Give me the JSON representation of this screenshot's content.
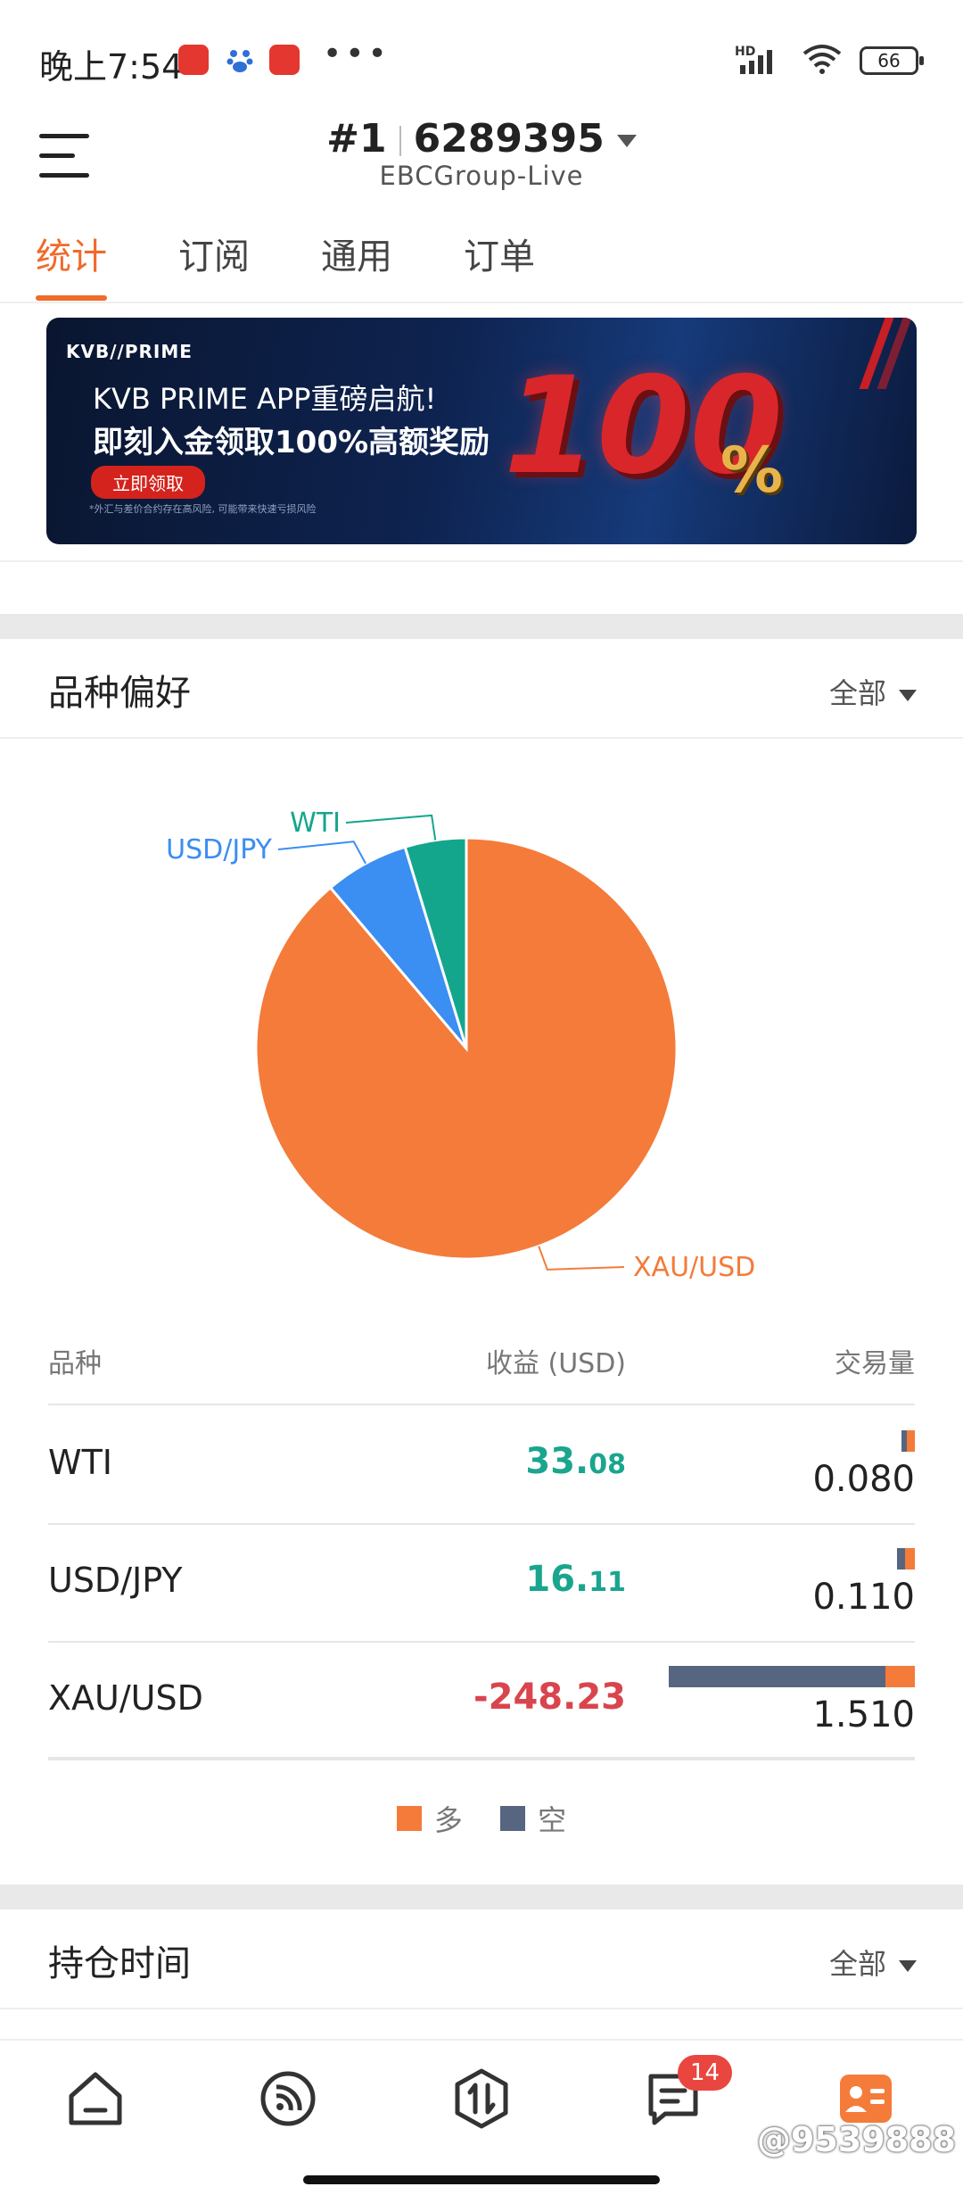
{
  "status_bar": {
    "time": "晚上7:54",
    "battery": "66",
    "network": "HD"
  },
  "header": {
    "account_prefix": "#1",
    "account_number": "6289395",
    "server": "EBCGroup-Live"
  },
  "tabs": [
    {
      "label": "统计",
      "active": true
    },
    {
      "label": "订阅",
      "active": false
    },
    {
      "label": "通用",
      "active": false
    },
    {
      "label": "订单",
      "active": false
    }
  ],
  "banner": {
    "brand": "KVB//PRIME",
    "line1": "KVB PRIME APP重磅启航!",
    "line2": "即刻入金领取100%高额奖励",
    "button": "立即领取",
    "note": "*外汇与差价合约存在高风险, 可能带来快速亏损风险",
    "big_number": "100",
    "percent": "%"
  },
  "symbol_preference": {
    "title": "品种偏好",
    "filter": "全部",
    "chart_data": {
      "type": "pie",
      "slices": [
        {
          "label": "XAU/USD",
          "value": 1.51,
          "color": "#f47b3a"
        },
        {
          "label": "USD/JPY",
          "value": 0.11,
          "color": "#3b8ef2"
        },
        {
          "label": "WTI",
          "value": 0.08,
          "color": "#14a68c"
        }
      ]
    },
    "table": {
      "headers": {
        "symbol": "品种",
        "profit": "收益 (USD)",
        "volume": "交易量"
      },
      "rows": [
        {
          "symbol": "WTI",
          "profit_int": "33.",
          "profit_dec": "08",
          "profit_sign": "pos",
          "volume": "0.080",
          "short_frac": 0.4,
          "long_frac": 0.6,
          "total": 0.08
        },
        {
          "symbol": "USD/JPY",
          "profit_int": "16.",
          "profit_dec": "11",
          "profit_sign": "pos",
          "volume": "0.110",
          "short_frac": 0.45,
          "long_frac": 0.55,
          "total": 0.11
        },
        {
          "symbol": "XAU/USD",
          "profit_int": "-248.23",
          "profit_dec": "",
          "profit_sign": "neg",
          "volume": "1.510",
          "short_frac": 0.88,
          "long_frac": 0.12,
          "total": 1.51
        }
      ]
    },
    "legend": [
      {
        "label": "多",
        "color": "#f47b3a"
      },
      {
        "label": "空",
        "color": "#566580"
      }
    ]
  },
  "holding_time": {
    "title": "持仓时间",
    "filter": "全部"
  },
  "bottom_nav": {
    "messages_badge": "14"
  },
  "watermark": "@9539888"
}
